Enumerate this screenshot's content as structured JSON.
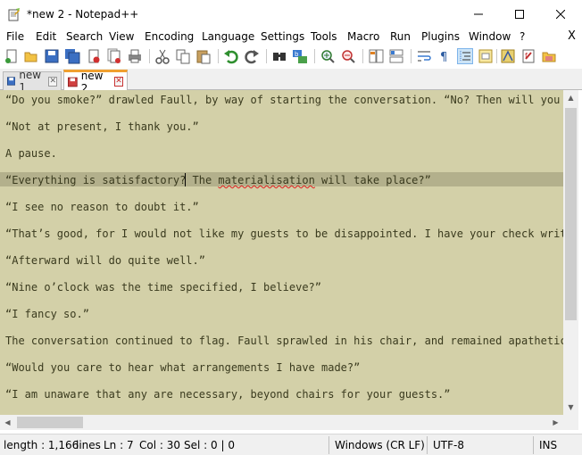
{
  "window": {
    "title": "*new 2 - Notepad++",
    "minimize": "─",
    "maximize": "☐",
    "close": "✕"
  },
  "menu": {
    "items": [
      "File",
      "Edit",
      "Search",
      "View",
      "Encoding",
      "Language",
      "Settings",
      "Tools",
      "Macro",
      "Run",
      "Plugins",
      "Window",
      "?"
    ],
    "close_x": "X"
  },
  "toolbar": {
    "icons": [
      "new-file-icon",
      "open-file-icon",
      "save-icon",
      "save-all-icon",
      "close-icon",
      "close-all-icon",
      "print-icon",
      "cut-icon",
      "copy-icon",
      "paste-icon",
      "undo-icon",
      "redo-icon",
      "find-icon",
      "replace-icon",
      "zoom-in-icon",
      "zoom-out-icon",
      "sync-vertical-icon",
      "sync-horizontal-icon",
      "word-wrap-icon",
      "show-all-chars-icon",
      "indent-guide-icon",
      "doc-map-icon",
      "function-list-icon",
      "folder-workspace-icon",
      "monitoring-icon",
      "record-macro-icon"
    ]
  },
  "tabs": [
    {
      "label": "new 1",
      "close": "✕",
      "active": false
    },
    {
      "label": "new 2",
      "close": "✕",
      "active": true
    }
  ],
  "editor": {
    "bg_color": "#d3d0a8",
    "current_line_color": "#b3b08c",
    "lines": [
      "“Do you smoke?” drawled Faull, by way of starting the conversation. “No? Then will you t",
      "",
      "“Not at present, I thank you.”",
      "",
      "A pause.",
      "",
      "“Everything is satisfactory? The materialisation will take place?”",
      "",
      "“I see no reason to doubt it.”",
      "",
      "“That’s good, for I would not like my guests to be disappointed. I have your check writte",
      "",
      "“Afterward will do quite well.”",
      "",
      "“Nine o’clock was the time specified, I believe?”",
      "",
      "“I fancy so.”",
      "",
      "The conversation continued to flag. Faull sprawled in his chair, and remained apathetic.",
      "",
      "“Would you care to hear what arrangements I have made?”",
      "",
      "“I am unaware that any are necessary, beyond chairs for your guests.”"
    ],
    "line6_parts": [
      "“Everything is satisfactory? The ",
      "materialisation",
      " will take place?”"
    ]
  },
  "status": {
    "length": "length : 1,166",
    "lines": "lines",
    "ln": "Ln : 7",
    "col": "Col : 30",
    "sel": "Sel : 0 | 0",
    "eol": "Windows (CR LF)",
    "encoding": "UTF-8",
    "mode": "INS"
  },
  "scrollbar": {
    "up": "▲",
    "down": "▼",
    "left": "◀",
    "right": "▶"
  }
}
